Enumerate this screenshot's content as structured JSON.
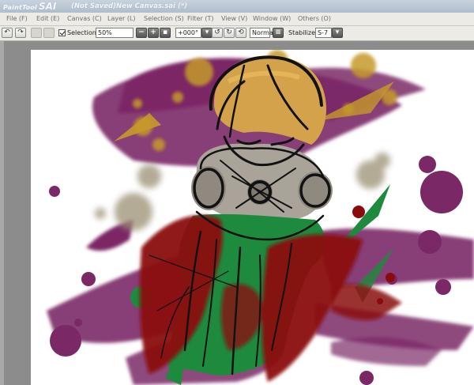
{
  "app": {
    "logo_small": "PaintTool",
    "logo_big": "SAI",
    "window_title": "(Not Saved)New Canvas.sai (*)"
  },
  "menu": [
    {
      "label": "File (F)",
      "id": "file"
    },
    {
      "label": "Edit (E)",
      "id": "edit"
    },
    {
      "label": "Canvas (C)",
      "id": "canvas"
    },
    {
      "label": "Layer (L)",
      "id": "layer"
    },
    {
      "label": "Selection (S)",
      "id": "selection"
    },
    {
      "label": "Filter (T)",
      "id": "filter"
    },
    {
      "label": "View (V)",
      "id": "view"
    },
    {
      "label": "Window (W)",
      "id": "window"
    },
    {
      "label": "Others (O)",
      "id": "others"
    }
  ],
  "toolbar": {
    "selection_label": "Selection",
    "selection_checked": true,
    "zoom_value": "50%",
    "rotation_value": "+000°",
    "blend_mode": "Normal",
    "stabilizer_label": "Stabilizer",
    "stabilizer_value": "S-7",
    "icons": {
      "undo": "undo-icon",
      "redo": "redo-icon",
      "zoom_out": "minus-icon",
      "zoom_in": "plus-icon",
      "zoom_reset": "reset-icon",
      "rotate_left": "rotate-left-icon",
      "rotate_right": "rotate-right-icon",
      "rotate_reset": "rotate-reset-icon",
      "flip": "flip-icon"
    }
  },
  "colors": {
    "workspace_gray": "#8c8c8c",
    "purple": "#7b2866",
    "gold": "#c59a2a",
    "green": "#1e8a3e",
    "red": "#8a0b0b",
    "ink": "#121212"
  }
}
